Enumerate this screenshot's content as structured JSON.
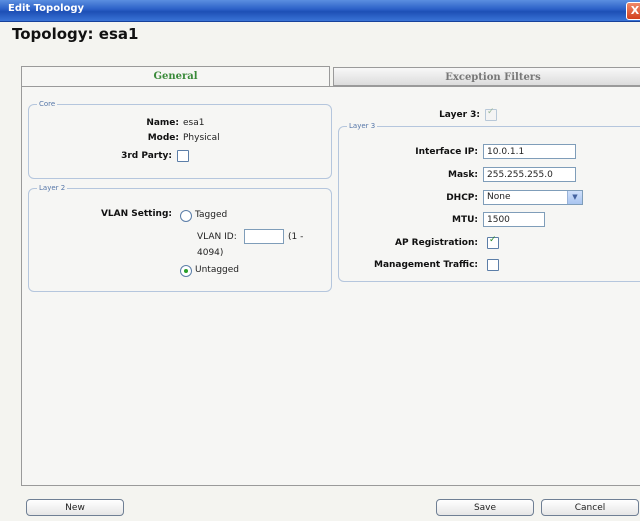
{
  "window": {
    "title": "Edit Topology",
    "close_glyph": "X"
  },
  "heading": "Topology: esa1",
  "tabs": [
    {
      "label": "General",
      "active": true
    },
    {
      "label": "Exception Filters",
      "active": false
    }
  ],
  "core": {
    "legend": "Core",
    "name_label": "Name:",
    "name_value": "esa1",
    "mode_label": "Mode:",
    "mode_value": "Physical",
    "third_party_label": "3rd Party:",
    "third_party_checked": false
  },
  "layer2": {
    "legend": "Layer 2",
    "vlan_setting_label": "VLAN Setting:",
    "tagged_label": "Tagged",
    "vlan_id_label": "VLAN ID:",
    "vlan_id_value": "",
    "vlan_range_a": "(1 -",
    "vlan_range_b": "4094)",
    "untagged_label": "Untagged",
    "selected": "Untagged"
  },
  "layer3_toggle": {
    "label": "Layer 3:",
    "checked": true
  },
  "layer3": {
    "legend": "Layer 3",
    "interface_ip_label": "Interface IP:",
    "interface_ip_value": "10.0.1.1",
    "mask_label": "Mask:",
    "mask_value": "255.255.255.0",
    "dhcp_label": "DHCP:",
    "dhcp_value": "None",
    "mtu_label": "MTU:",
    "mtu_value": "1500",
    "ap_registration_label": "AP Registration:",
    "ap_registration_checked": true,
    "management_traffic_label": "Management Traffic:",
    "management_traffic_checked": false
  },
  "buttons": {
    "new": "New",
    "save": "Save",
    "cancel": "Cancel"
  },
  "colors": {
    "title_bar": "#2a5fc6",
    "active_tab_text": "#3a8a3a",
    "legend_text": "#5576a8"
  }
}
